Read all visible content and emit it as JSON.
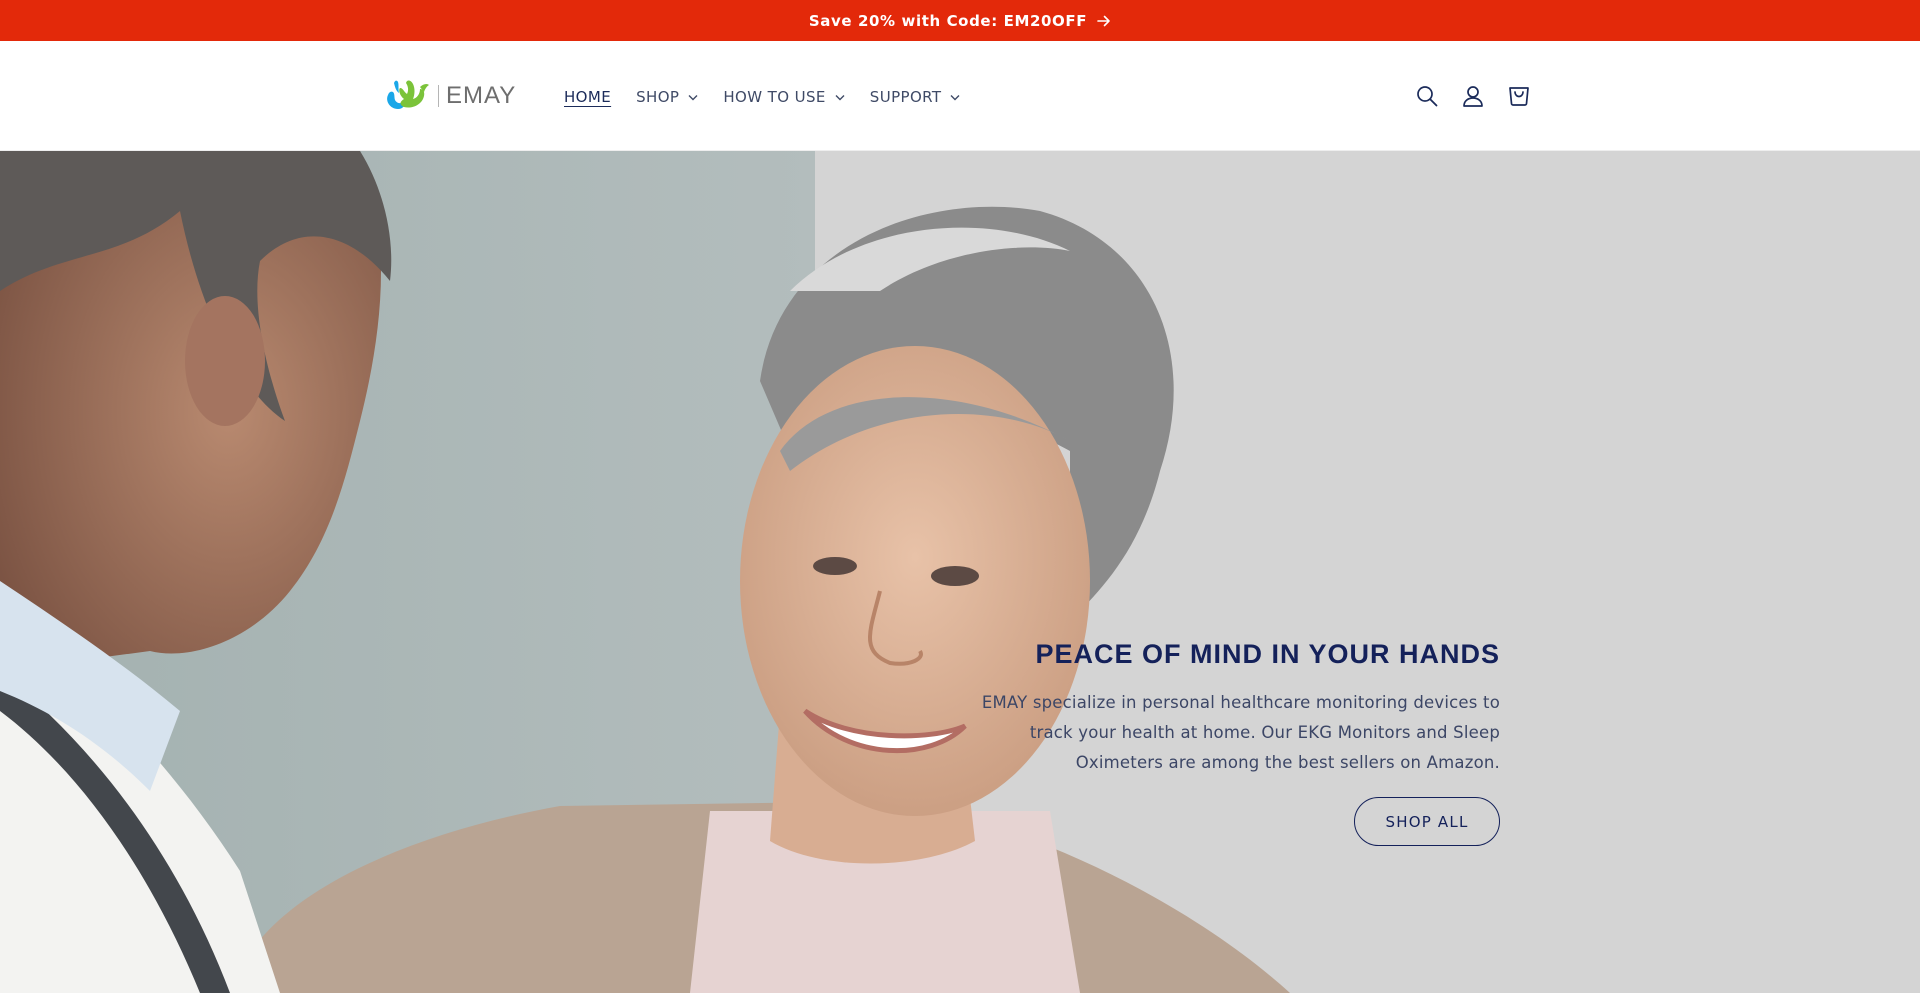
{
  "announcement": {
    "text": "Save 20% with Code: EM20OFF"
  },
  "header": {
    "logo_text": "EMAY",
    "nav": [
      {
        "label": "HOME",
        "active": true,
        "has_dropdown": false
      },
      {
        "label": "SHOP",
        "active": false,
        "has_dropdown": true
      },
      {
        "label": "HOW TO USE",
        "active": false,
        "has_dropdown": true
      },
      {
        "label": "SUPPORT",
        "active": false,
        "has_dropdown": true
      }
    ],
    "icons": [
      "search-icon",
      "account-icon",
      "cart-icon"
    ]
  },
  "hero": {
    "title": "PEACE OF MIND IN YOUR HANDS",
    "description": "EMAY specialize in personal healthcare monitoring devices to track your health at home. Our EKG Monitors and Sleep Oximeters are among the best sellers on Amazon.",
    "button_label": "SHOP ALL"
  },
  "colors": {
    "announcement_bg": "#e3290a",
    "brand_navy": "#14215a",
    "logo_blue": "#1aa7e8",
    "logo_green": "#7bc33a"
  }
}
